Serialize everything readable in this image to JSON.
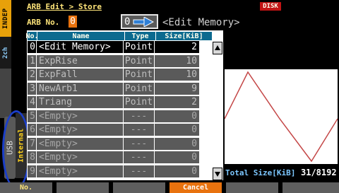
{
  "side_tabs": {
    "indep": "INDEP",
    "channel": "2ch",
    "usb": "USB",
    "internal": "Internal"
  },
  "header": {
    "breadcrumb": "ARB Edit > Store",
    "disk_badge": "DISK",
    "arb_no_label": "ARB No.",
    "arb_no_value": "0",
    "target_slot": "0",
    "target_name": "<Edit Memory>"
  },
  "table": {
    "columns": [
      "No.",
      "Name",
      "Type",
      "Size[KiB]"
    ],
    "rows": [
      {
        "no": "0",
        "name": "<Edit Memory>",
        "type": "Point",
        "size": "2",
        "state": "sel"
      },
      {
        "no": "1",
        "name": "ExpRise",
        "type": "Point",
        "size": "10",
        "state": "norm"
      },
      {
        "no": "2",
        "name": "ExpFall",
        "type": "Point",
        "size": "10",
        "state": "norm"
      },
      {
        "no": "3",
        "name": "NewArb1",
        "type": "Point",
        "size": "9",
        "state": "norm"
      },
      {
        "no": "4",
        "name": "Triang",
        "type": "Point",
        "size": "2",
        "state": "norm"
      },
      {
        "no": "5",
        "name": "<Empty>",
        "type": "---",
        "size": "0",
        "state": "empty"
      },
      {
        "no": "6",
        "name": "<Empty>",
        "type": "---",
        "size": "0",
        "state": "empty"
      },
      {
        "no": "7",
        "name": "<Empty>",
        "type": "---",
        "size": "0",
        "state": "empty"
      },
      {
        "no": "8",
        "name": "<Empty>",
        "type": "---",
        "size": "0",
        "state": "empty"
      },
      {
        "no": "9",
        "name": "<Empty>",
        "type": "---",
        "size": "0",
        "state": "empty"
      }
    ]
  },
  "total": {
    "label": "Total Size[KiB]",
    "value": "31/8192"
  },
  "softkeys": [
    "No.",
    "",
    "",
    "Cancel",
    "",
    ""
  ],
  "colors": {
    "accent": "#e8720e",
    "header_bg": "#0c6a8f",
    "waveform": "#c44747",
    "highlight_ring": "#1b3ec8"
  }
}
